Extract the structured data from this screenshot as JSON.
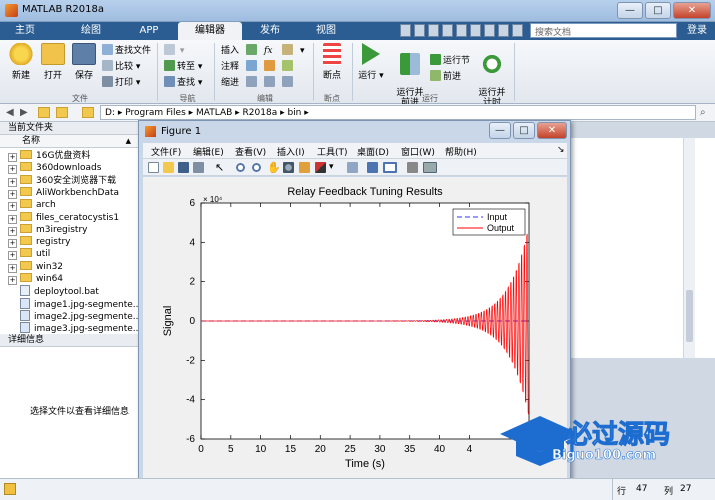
{
  "window": {
    "title": "MATLAB R2018a",
    "minimize": "—",
    "maximize": "□",
    "close": "✕"
  },
  "tabs": [
    {
      "label": "主页",
      "active": false
    },
    {
      "label": "绘图",
      "active": false
    },
    {
      "label": "APP",
      "active": false
    },
    {
      "label": "编辑器",
      "active": true
    },
    {
      "label": "发布",
      "active": false
    },
    {
      "label": "视图",
      "active": false
    }
  ],
  "search": {
    "placeholder": "搜索文档"
  },
  "login": "登录",
  "ribbon": {
    "file": {
      "new": "新建",
      "open": "打开",
      "save": "保存",
      "find_files": "查找文件",
      "compare": "比较",
      "print": "打印",
      "group": "文件"
    },
    "navigate": {
      "goto": "转至",
      "find": "查找",
      "group": "导航"
    },
    "edit": {
      "insert": "插入",
      "comment": "注释",
      "indent": "缩进",
      "fx": "fx",
      "group": "编辑"
    },
    "breakpoints": {
      "label": "断点",
      "group": "断点"
    },
    "run": {
      "run": "运行",
      "run_advance": "运行并\n前进",
      "run_section": "运行节",
      "advance": "前进",
      "run_time": "运行并\n计时",
      "group": "运行"
    }
  },
  "address": {
    "path": "D: ▸ Program Files ▸ MATLAB ▸ R2018a ▸ bin ▸"
  },
  "current_folder": {
    "title": "当前文件夹",
    "column": "名称",
    "column_sort": "▲",
    "folders": [
      "16G优盘资料",
      "360downloads",
      "360安全浏览器下载",
      "AliWorkbenchData",
      "arch",
      "files_ceratocystis1",
      "m3iregistry",
      "registry",
      "util",
      "win32",
      "win64"
    ],
    "files": [
      "deploytool.bat",
      "image1.jpg-segmente...",
      "image2.jpg-segmente...",
      "image3.jpg-segmente..."
    ]
  },
  "details": {
    "title": "详细信息",
    "message": "选择文件以查看详细信息"
  },
  "figure": {
    "title": "Figure 1",
    "menus": [
      "文件(F)",
      "编辑(E)",
      "查看(V)",
      "插入(I)",
      "工具(T)",
      "桌面(D)",
      "窗口(W)",
      "帮助(H)"
    ]
  },
  "status": {
    "row_label": "行",
    "row": "47",
    "col_label": "列",
    "col": "27"
  },
  "watermark": {
    "brand": "必过源码",
    "url": "Biguo100.com"
  },
  "colors": {
    "ribbon_blue": "#2b5d92",
    "input_line": "#3333ff",
    "output_line": "#ff0000"
  },
  "chart_data": {
    "type": "line",
    "title": "Relay Feedback Tuning Results",
    "xlabel": "Time (s)",
    "ylabel": "Signal",
    "y_exponent_label": "× 10⁴",
    "xlim": [
      0,
      55
    ],
    "ylim": [
      -6,
      6
    ],
    "xticks": [
      "0",
      "5",
      "10",
      "15",
      "20",
      "25",
      "30",
      "35",
      "40",
      "4"
    ],
    "yticks": [
      "6",
      "4",
      "2",
      "0",
      "-2",
      "-4",
      "-6"
    ],
    "legend": {
      "position": "top-right",
      "entries": [
        "Input",
        "Output"
      ]
    },
    "series": [
      {
        "name": "Input",
        "style": "dashed",
        "color": "#3333ff",
        "description_values": {
          "amplitude": 0
        }
      },
      {
        "name": "Output",
        "style": "solid",
        "color": "#ff0000",
        "oscillation": {
          "start_time": 28,
          "period": 0.45,
          "growth_rate": 0.3,
          "amplitude_at_end": 5.6,
          "end_time": 55
        }
      }
    ]
  }
}
